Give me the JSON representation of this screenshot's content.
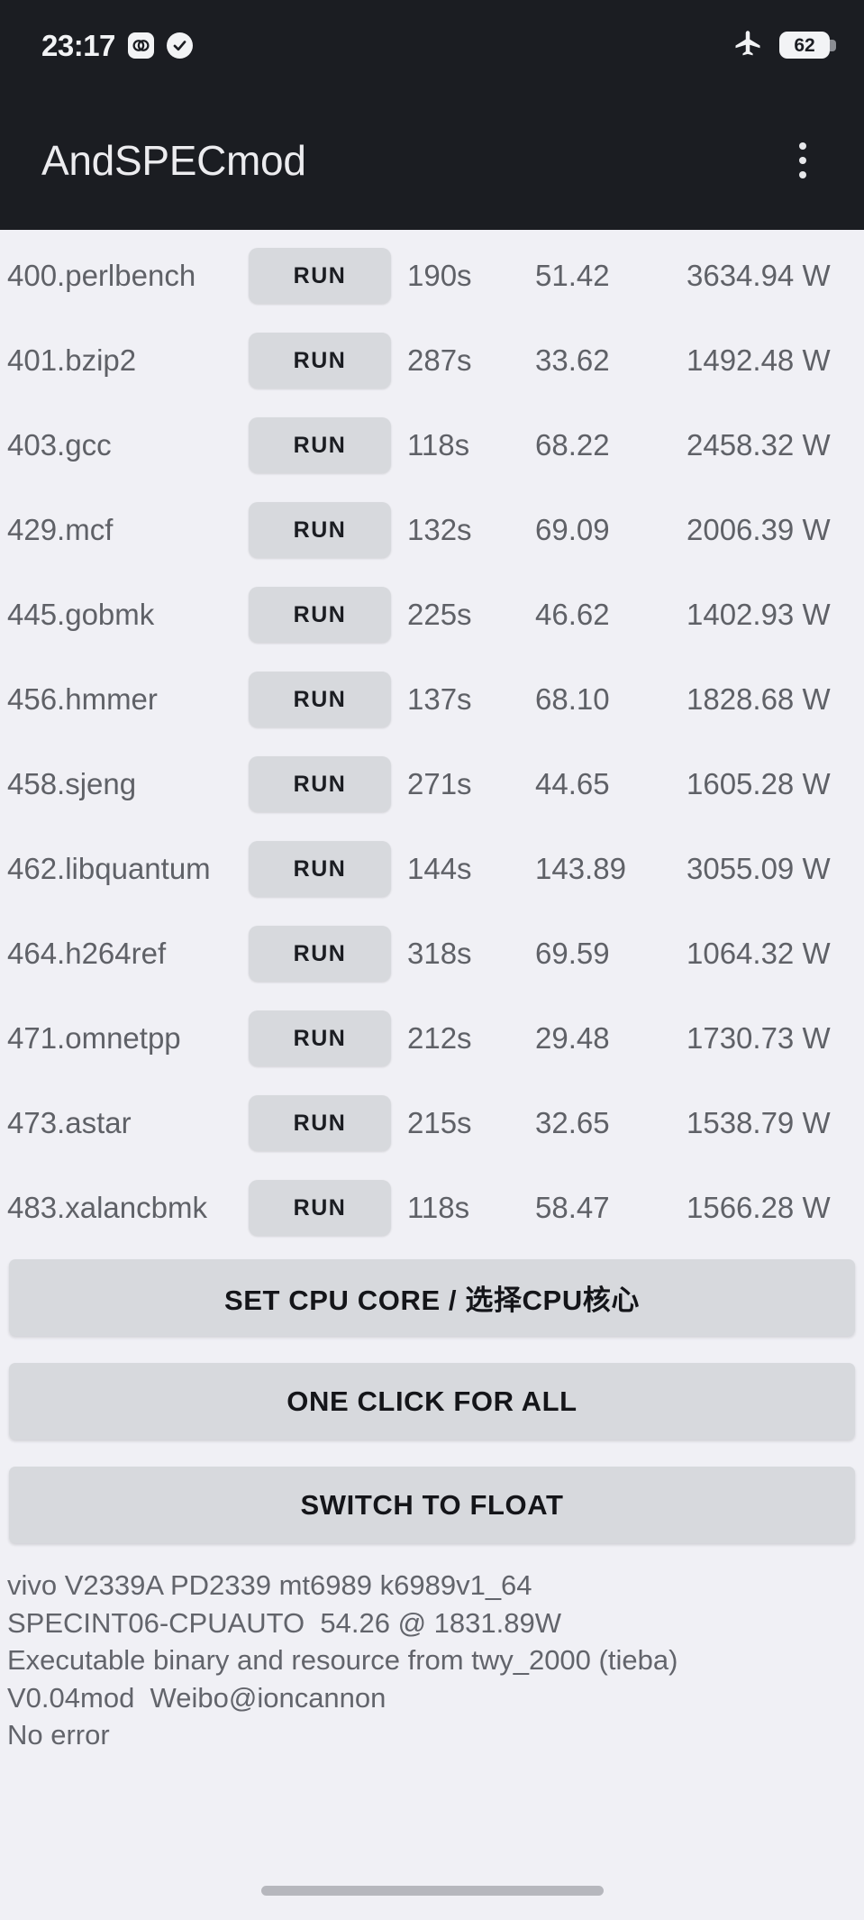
{
  "statusbar": {
    "time": "23:17",
    "icons": [
      "link-circles-icon",
      "check-circle-icon"
    ],
    "airplane_icon": "airplane-mode-icon",
    "battery_level": "62"
  },
  "appbar": {
    "title": "AndSPECmod",
    "overflow_icon": "overflow-menu-icon"
  },
  "benchmarks": {
    "run_label": "RUN",
    "rows": [
      {
        "name": "400.perlbench",
        "time": "190s",
        "score": "51.42",
        "power": "3634.94 W"
      },
      {
        "name": "401.bzip2",
        "time": "287s",
        "score": "33.62",
        "power": "1492.48 W"
      },
      {
        "name": "403.gcc",
        "time": "118s",
        "score": "68.22",
        "power": "2458.32 W"
      },
      {
        "name": "429.mcf",
        "time": "132s",
        "score": "69.09",
        "power": "2006.39 W"
      },
      {
        "name": "445.gobmk",
        "time": "225s",
        "score": "46.62",
        "power": "1402.93 W"
      },
      {
        "name": "456.hmmer",
        "time": "137s",
        "score": "68.10",
        "power": "1828.68 W"
      },
      {
        "name": "458.sjeng",
        "time": "271s",
        "score": "44.65",
        "power": "1605.28 W"
      },
      {
        "name": "462.libquantum",
        "time": "144s",
        "score": "143.89",
        "power": "3055.09 W"
      },
      {
        "name": "464.h264ref",
        "time": "318s",
        "score": "69.59",
        "power": "1064.32 W"
      },
      {
        "name": "471.omnetpp",
        "time": "212s",
        "score": "29.48",
        "power": "1730.73 W"
      },
      {
        "name": "473.astar",
        "time": "215s",
        "score": "32.65",
        "power": "1538.79 W"
      },
      {
        "name": "483.xalancbmk",
        "time": "118s",
        "score": "58.47",
        "power": "1566.28 W"
      }
    ]
  },
  "actions": {
    "set_cpu_core": "SET CPU CORE / 选择CPU核心",
    "one_click_for_all": "ONE CLICK FOR ALL",
    "switch_to_float": "SWITCH TO FLOAT"
  },
  "footer": {
    "device": "vivo V2339A PD2339 mt6989 k6989v1_64",
    "result": "SPECINT06-CPUAUTO  54.26 @ 1831.89W",
    "credit": "Executable binary and resource from twy_2000 (tieba)",
    "version": "V0.04mod  Weibo@ioncannon",
    "status": "No error"
  },
  "colors": {
    "statusbar_bg": "#1b1d22",
    "page_bg": "#f0f0f5",
    "button_bg": "#d7d9dd",
    "text_muted": "#5f6167"
  }
}
